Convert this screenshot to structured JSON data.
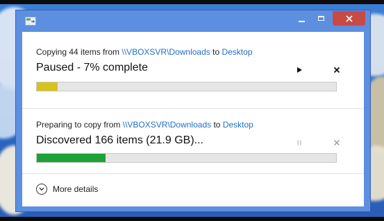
{
  "window": {
    "title": "",
    "accent": "#5d8fe0",
    "close_color": "#c84a45"
  },
  "operations": [
    {
      "prefix": "Copying 44 items from ",
      "source": "\\\\VBOXSVR\\Downloads",
      "middle": " to ",
      "destination": "Desktop",
      "status": "Paused - 7% complete",
      "progress": 0.07,
      "bar_color": "#d8c21e",
      "controls": [
        "play-icon",
        "close-icon"
      ]
    },
    {
      "prefix": "Preparing to copy from ",
      "source": "\\\\VBOXSVR\\Downloads",
      "middle": " to ",
      "destination": "Desktop",
      "status": "Discovered 166 items (21.9 GB)...",
      "progress": 0.23,
      "bar_color": "#1ea238",
      "controls": [
        "pause-icon",
        "close-icon"
      ]
    }
  ],
  "details": {
    "label": "More details"
  }
}
